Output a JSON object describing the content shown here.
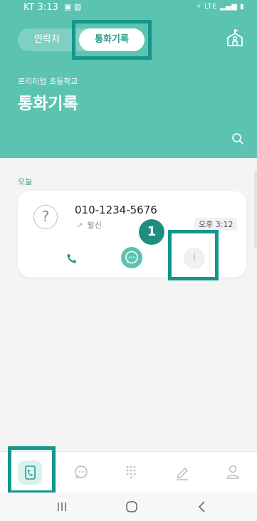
{
  "status_bar": {
    "time": "KT 3:13",
    "left_icons": "▣ ▨",
    "right_icons": "⚡ LTE ▂▄▆ ▮"
  },
  "header": {
    "tabs": [
      {
        "label": "연락처"
      },
      {
        "label": "통화기록"
      }
    ],
    "subtitle": "프리미엄 초등학교",
    "title": "통화기록",
    "icons": [
      "school-icon",
      "search-icon"
    ]
  },
  "call_log": {
    "section_label": "오늘",
    "items": [
      {
        "avatar": "?",
        "number": "010-1234-5676",
        "direction": "발신",
        "direction_icon": "↗",
        "time": "오후 3:12",
        "actions": [
          "call-icon",
          "message-icon",
          "info-icon"
        ],
        "info_symbol": "i"
      }
    ]
  },
  "step_badge": "1",
  "bottom_nav": {
    "items": [
      "calls-icon",
      "chat-icon",
      "keypad-icon",
      "note-icon",
      "profile-icon"
    ],
    "active": "calls-icon"
  },
  "colors": {
    "accent": "#5cc3b1",
    "highlight": "#12978a",
    "badge": "#1f8e81"
  }
}
